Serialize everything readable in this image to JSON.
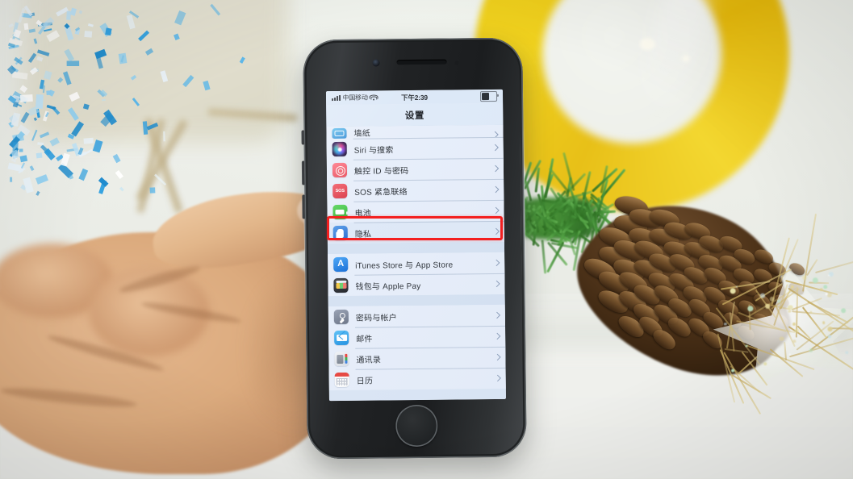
{
  "scene": {
    "description": "Hand holding a space-gray iPhone showing the iOS Settings app, with a red highlight box around the Privacy row",
    "background_items": [
      "blurred-chair",
      "blue-confetti",
      "yellow-ring-ornament",
      "pine-branch",
      "pinecone",
      "wire-star-ornament"
    ],
    "highlight_color": "#f32020"
  },
  "phone": {
    "color_name": "space-gray",
    "hardware": [
      "earpiece",
      "front-camera",
      "proximity-sensor",
      "home-button",
      "volume-buttons",
      "mute-switch"
    ]
  },
  "statusbar": {
    "carrier": "中国移动",
    "signal_bars": 4,
    "wifi_icon": "wifi-icon",
    "time": "下午2:39",
    "battery_icon": "battery-icon",
    "battery_level_pct": 52
  },
  "navbar": {
    "title": "设置"
  },
  "list": {
    "groups": [
      {
        "partial_top": true,
        "rows": [
          {
            "label": "墙纸",
            "icon": "wallpaper-icon",
            "icon_class": "ic-wallpaper",
            "partial": true,
            "highlighted": false
          },
          {
            "label": "Siri 与搜索",
            "icon": "siri-icon",
            "icon_class": "ic-siri",
            "partial": false,
            "highlighted": false
          },
          {
            "label": "触控 ID 与密码",
            "icon": "touch-id-icon",
            "icon_class": "ic-touchid",
            "partial": false,
            "highlighted": false
          },
          {
            "label": "SOS 紧急联络",
            "icon": "sos-icon",
            "icon_class": "ic-sos",
            "partial": false,
            "highlighted": false
          },
          {
            "label": "电池",
            "icon": "battery-icon",
            "icon_class": "ic-battery",
            "partial": false,
            "highlighted": false
          },
          {
            "label": "隐私",
            "icon": "privacy-hand-icon",
            "icon_class": "ic-privacy",
            "partial": false,
            "highlighted": true
          }
        ]
      },
      {
        "partial_top": false,
        "rows": [
          {
            "label": "iTunes Store 与 App Store",
            "icon": "app-store-icon",
            "icon_class": "ic-appstore",
            "partial": false,
            "highlighted": false
          },
          {
            "label": "钱包与 Apple Pay",
            "icon": "wallet-icon",
            "icon_class": "ic-wallet",
            "partial": false,
            "highlighted": false
          }
        ]
      },
      {
        "partial_top": false,
        "rows": [
          {
            "label": "密码与帐户",
            "icon": "passwords-key-icon",
            "icon_class": "ic-passwords",
            "partial": false,
            "highlighted": false
          },
          {
            "label": "邮件",
            "icon": "mail-icon",
            "icon_class": "ic-mail",
            "partial": false,
            "highlighted": false
          },
          {
            "label": "通讯录",
            "icon": "contacts-icon",
            "icon_class": "ic-contacts",
            "partial": false,
            "highlighted": false
          },
          {
            "label": "日历",
            "icon": "calendar-icon",
            "icon_class": "ic-calendar",
            "partial": false,
            "highlighted": false
          }
        ]
      }
    ],
    "chevron_icon": "chevron-right-icon",
    "sos_badge_text": "SOS",
    "appstore_glyph": "A"
  }
}
